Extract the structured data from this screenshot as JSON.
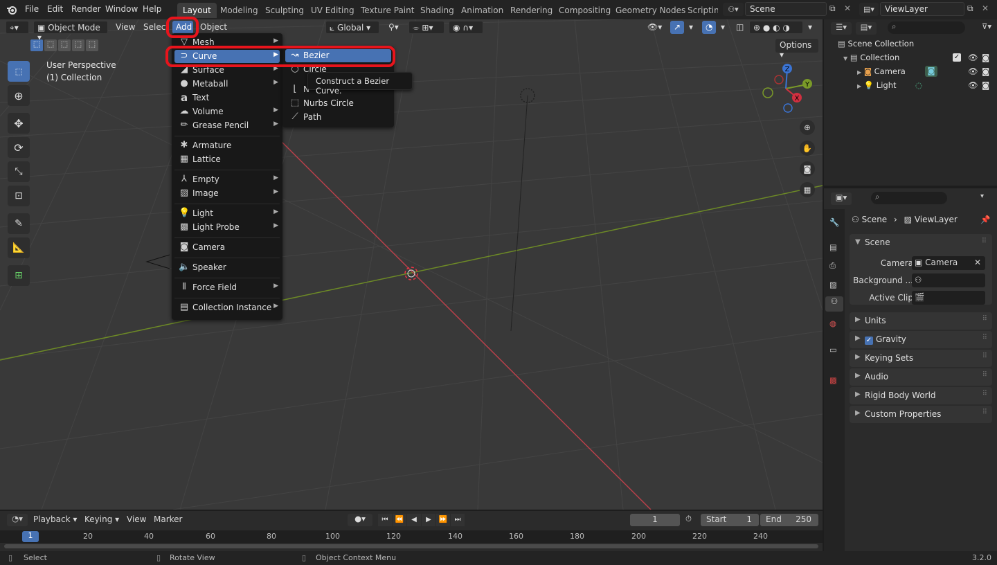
{
  "topbar": {
    "menus": [
      "File",
      "Edit",
      "Render",
      "Window",
      "Help"
    ],
    "workspaces": [
      "Layout",
      "Modeling",
      "Sculpting",
      "UV Editing",
      "Texture Paint",
      "Shading",
      "Animation",
      "Rendering",
      "Compositing",
      "Geometry Nodes",
      "Scripting"
    ],
    "active_workspace": "Layout",
    "scene_name": "Scene",
    "view_layer": "ViewLayer"
  },
  "viewport_header": {
    "mode": "Object Mode",
    "view": "View",
    "select": "Select",
    "add": "Add",
    "object": "Object",
    "orientation": "Global",
    "options": "Options"
  },
  "overlay": {
    "perspective": "User Perspective",
    "collection": "(1) Collection"
  },
  "add_menu": {
    "items": [
      {
        "label": "Mesh",
        "icon": "mesh-icon",
        "submenu": true
      },
      {
        "label": "Curve",
        "icon": "curve-icon",
        "submenu": true
      },
      {
        "label": "Surface",
        "icon": "surface-icon",
        "submenu": true
      },
      {
        "label": "Metaball",
        "icon": "metaball-icon",
        "submenu": true
      },
      {
        "label": "Text",
        "icon": "text-icon",
        "submenu": false
      },
      {
        "label": "Volume",
        "icon": "volume-icon",
        "submenu": true
      },
      {
        "label": "Grease Pencil",
        "icon": "grease-pencil-icon",
        "submenu": true
      },
      {
        "label": "Armature",
        "icon": "armature-icon",
        "submenu": false
      },
      {
        "label": "Lattice",
        "icon": "lattice-icon",
        "submenu": false
      },
      {
        "label": "Empty",
        "icon": "empty-icon",
        "submenu": true
      },
      {
        "label": "Image",
        "icon": "image-icon",
        "submenu": true
      },
      {
        "label": "Light",
        "icon": "light-icon",
        "submenu": true
      },
      {
        "label": "Light Probe",
        "icon": "light-probe-icon",
        "submenu": true
      },
      {
        "label": "Camera",
        "icon": "camera-icon",
        "submenu": false
      },
      {
        "label": "Speaker",
        "icon": "speaker-icon",
        "submenu": false
      },
      {
        "label": "Force Field",
        "icon": "force-field-icon",
        "submenu": true
      },
      {
        "label": "Collection Instance",
        "icon": "collection-instance-icon",
        "submenu": true
      }
    ],
    "highlighted": "Curve"
  },
  "curve_submenu": {
    "items": [
      {
        "label": "Bezier",
        "icon": "bezier-icon"
      },
      {
        "label": "Circle",
        "icon": "circle-icon"
      },
      {
        "label": "N",
        "icon": "nurbs-curve-icon"
      },
      {
        "label": "Nurbs Circle",
        "icon": "nurbs-circle-icon"
      },
      {
        "label": "Path",
        "icon": "path-icon"
      }
    ],
    "highlighted": "Bezier"
  },
  "tooltip": "Construct a Bezier Curve.",
  "outliner": {
    "root": "Scene Collection",
    "collection": "Collection",
    "objects": [
      "Camera",
      "Light"
    ]
  },
  "properties": {
    "breadcrumb_scene": "Scene",
    "breadcrumb_layer": "ViewLayer",
    "scene_panel": "Scene",
    "camera_label": "Camera",
    "camera_value": "Camera",
    "background_label": "Background ...",
    "active_clip_label": "Active Clip",
    "panels": [
      "Units",
      "Gravity",
      "Keying Sets",
      "Audio",
      "Rigid Body World",
      "Custom Properties"
    ],
    "gravity_checked": true
  },
  "timeline": {
    "playback": "Playback",
    "keying": "Keying",
    "view": "View",
    "marker": "Marker",
    "current_frame": "1",
    "start_label": "Start",
    "start": "1",
    "end_label": "End",
    "end": "250",
    "ruler": [
      "1",
      "20",
      "40",
      "60",
      "80",
      "100",
      "120",
      "140",
      "160",
      "180",
      "200",
      "220",
      "240"
    ]
  },
  "statusbar": {
    "select": "Select",
    "rotate": "Rotate View",
    "context": "Object Context Menu",
    "version": "3.2.0"
  },
  "colors": {
    "accent": "#4772b3",
    "annotation": "#e8141c",
    "x_axis": "#b8404a",
    "y_axis": "#7a9a28"
  }
}
